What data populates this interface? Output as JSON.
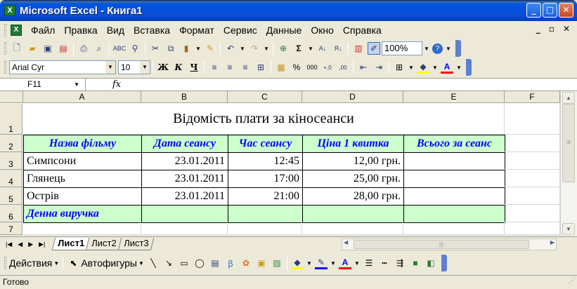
{
  "window": {
    "title": "Microsoft Excel - Книга1",
    "app_icon": "excel-icon"
  },
  "menu": [
    "Файл",
    "Правка",
    "Вид",
    "Вставка",
    "Формат",
    "Сервис",
    "Данные",
    "Окно",
    "Справка"
  ],
  "toolbar": {
    "zoom": "100%",
    "font_name": "Arial Cyr",
    "font_size": "10",
    "bold": "Ж",
    "italic": "К",
    "underline": "Ч",
    "percent": "%",
    "thousands": "000"
  },
  "formula_bar": {
    "cell_ref": "F11",
    "fx": "fx",
    "value": ""
  },
  "columns": [
    "A",
    "B",
    "C",
    "D",
    "E",
    "F"
  ],
  "rows": [
    "1",
    "2",
    "3",
    "4",
    "5",
    "6",
    "7"
  ],
  "cells": {
    "title": "Відомість плати за кіносеанси",
    "headers": [
      "Назва фільму",
      "Дата сеансу",
      "Час сеансу",
      "Ціна 1 квитка",
      "Всього за сеанс"
    ],
    "data": [
      [
        "Симпсони",
        "23.01.2011",
        "12:45",
        "12,00 грн.",
        ""
      ],
      [
        "Глянець",
        "23.01.2011",
        "17:00",
        "25,00 грн.",
        ""
      ],
      [
        "Острів",
        "23.01.2011",
        "21:00",
        "28,00 грн.",
        ""
      ]
    ],
    "total_label": "Денна виручка"
  },
  "sheet_tabs": [
    "Лист1",
    "Лист2",
    "Лист3"
  ],
  "active_tab": "Лист1",
  "drawing": {
    "actions": "Действия",
    "autoshapes": "Автофигуры"
  },
  "status": "Готово",
  "colors": {
    "header_fill": "#ccffcc",
    "header_text": "#0000ff",
    "title_bar": "#0054e3"
  }
}
